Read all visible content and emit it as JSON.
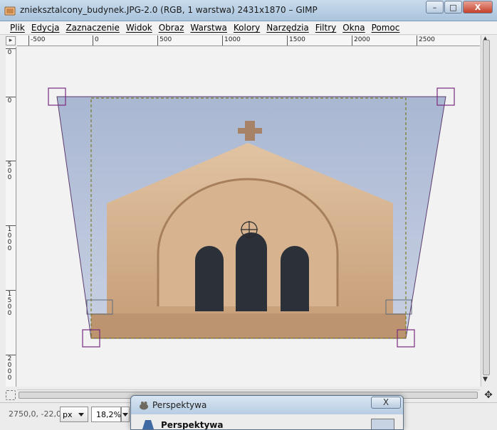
{
  "window": {
    "title": "znieksztalcony_budynek.JPG-2.0 (RGB, 1 warstwa) 2431x1870 – GIMP",
    "controls": {
      "minimize": "–",
      "maximize": "□",
      "close": "X"
    }
  },
  "menu": [
    "Plik",
    "Edycja",
    "Zaznaczenie",
    "Widok",
    "Obraz",
    "Warstwa",
    "Kolory",
    "Narzędzia",
    "Filtry",
    "Okna",
    "Pomoc"
  ],
  "ruler": {
    "horizontal_labels": [
      "-500",
      "0",
      "500",
      "1000",
      "1500",
      "2000",
      "2500"
    ],
    "vertical_labels": [
      "0",
      "0",
      "500",
      "1000",
      "1500",
      "2000"
    ]
  },
  "status": {
    "coords": "2750,0, -22,0",
    "unit": "px",
    "zoom": "18,2%"
  },
  "dialog": {
    "title": "Perspektywa",
    "heading": "Perspektywa",
    "close_label": "X"
  },
  "colors": {
    "handle": "#7b2a7d",
    "selection_dash": "#7a7a00",
    "sky_top": "#a9b7d2",
    "stone": "#d8b794"
  }
}
